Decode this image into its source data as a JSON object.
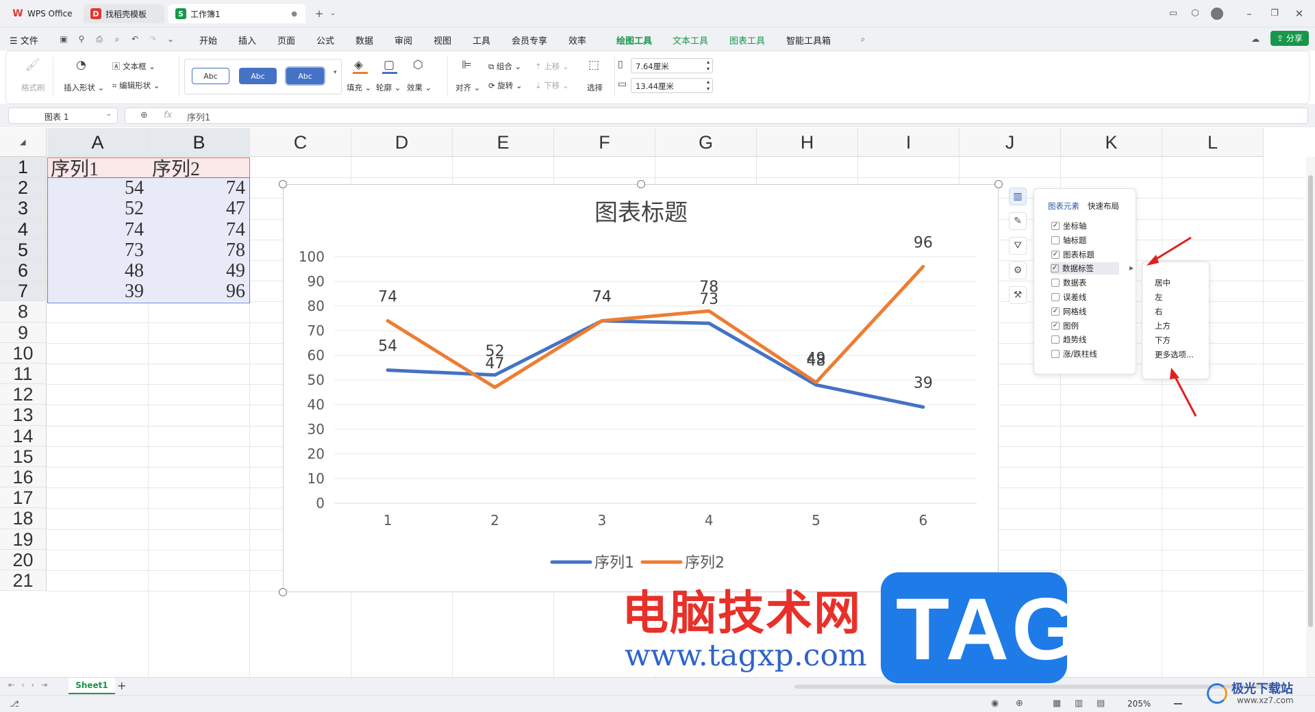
{
  "tabs": [
    {
      "label": "WPS Office",
      "icon": "wps-logo-icon",
      "color": "#e5362d"
    },
    {
      "label": "找稻壳模板",
      "icon": "docer-icon",
      "color": "#e5362d"
    },
    {
      "label": "工作簿1",
      "icon": "spreadsheet-icon",
      "color": "#17974b"
    }
  ],
  "menubar": {
    "file": "文件",
    "items": [
      "开始",
      "插入",
      "页面",
      "公式",
      "数据",
      "审阅",
      "视图",
      "工具",
      "会员专享",
      "效率",
      "绘图工具",
      "文本工具",
      "图表工具",
      "智能工具箱"
    ],
    "selected": "绘图工具",
    "share": "分享"
  },
  "ribbon": {
    "format_painter": "格式刷",
    "insert_shape": "插入形状",
    "text_box": "文本框",
    "edit_shape": "编辑形状",
    "style_sample": "Abc",
    "fill": "填充",
    "outline": "轮廓",
    "effect": "效果",
    "align": "对齐",
    "group": "组合",
    "rotate": "旋转",
    "move_up": "上移",
    "move_down": "下移",
    "select": "选择",
    "height": "7.64厘米",
    "width": "13.44厘米"
  },
  "formula": {
    "namebox": "图表 1",
    "fx": "fx",
    "content": "序列1"
  },
  "sheet": {
    "columns": [
      "A",
      "B",
      "C",
      "D",
      "E",
      "F",
      "G",
      "H",
      "I",
      "J",
      "K",
      "L"
    ],
    "rows": [
      "1",
      "2",
      "3",
      "4",
      "5",
      "6",
      "7",
      "8",
      "9",
      "10",
      "11",
      "12",
      "13",
      "14",
      "15",
      "16",
      "17",
      "18",
      "19",
      "20",
      "21"
    ],
    "header": [
      "序列1",
      "序列2"
    ],
    "data": [
      [
        "54",
        "74"
      ],
      [
        "52",
        "47"
      ],
      [
        "74",
        "74"
      ],
      [
        "73",
        "78"
      ],
      [
        "48",
        "49"
      ],
      [
        "39",
        "96"
      ]
    ]
  },
  "chart_data": {
    "type": "line",
    "title": "图表标题",
    "categories": [
      "1",
      "2",
      "3",
      "4",
      "5",
      "6"
    ],
    "series": [
      {
        "name": "序列1",
        "values": [
          54,
          52,
          74,
          73,
          48,
          39
        ],
        "color": "#4472c4"
      },
      {
        "name": "序列2",
        "values": [
          74,
          47,
          74,
          78,
          49,
          96
        ],
        "color": "#ed7d31"
      }
    ],
    "ylim": [
      0,
      100
    ],
    "yticks": [
      "0",
      "10",
      "20",
      "30",
      "40",
      "50",
      "60",
      "70",
      "80",
      "90",
      "100"
    ],
    "grid": true,
    "legend": "bottom",
    "data_labels": true
  },
  "chart_panel": {
    "tab_elements": "图表元素",
    "tab_layout": "快速布局",
    "items": [
      {
        "label": "坐标轴",
        "checked": true
      },
      {
        "label": "轴标题",
        "checked": false
      },
      {
        "label": "图表标题",
        "checked": true
      },
      {
        "label": "数据标签",
        "checked": true
      },
      {
        "label": "数据表",
        "checked": false
      },
      {
        "label": "误差线",
        "checked": false
      },
      {
        "label": "网格线",
        "checked": true
      },
      {
        "label": "图例",
        "checked": true
      },
      {
        "label": "趋势线",
        "checked": false
      },
      {
        "label": "涨/跌柱线",
        "checked": false
      }
    ]
  },
  "submenu": [
    "居中",
    "左",
    "右",
    "上方",
    "下方",
    "更多选项..."
  ],
  "sheetbar": {
    "sheet_name": "Sheet1",
    "add": "+"
  },
  "status": {
    "zoom": "205%"
  },
  "watermark": {
    "text1": "电脑技术网",
    "url": "www.tagxp.com",
    "tag": "TAG",
    "corner": "极光下载站",
    "corner_url": "www.xz7.com"
  }
}
